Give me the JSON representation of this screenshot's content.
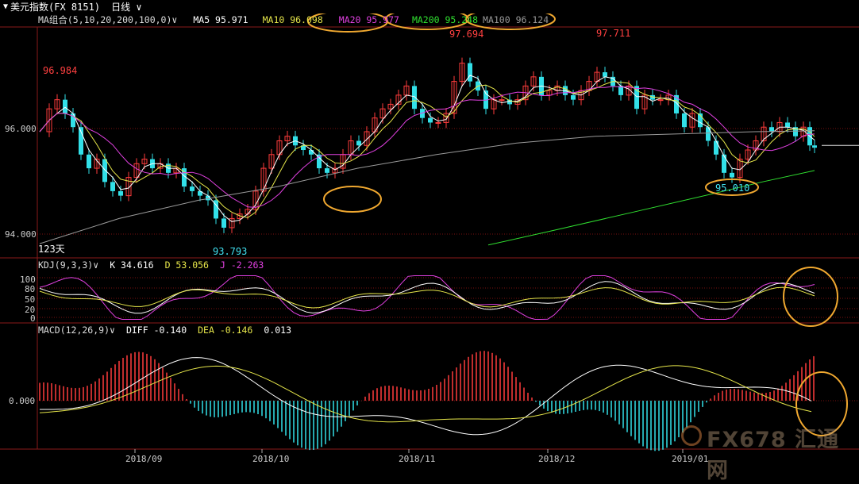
{
  "header": {
    "symbol_title": "美元指数(FX 8151)",
    "period": "日线",
    "period_arrow": "∨"
  },
  "ma_legend": {
    "label": "MA组合(5,10,20,200,100,0)",
    "arrow": "∨",
    "items": [
      {
        "text": "MA5 95.971",
        "color": "#ffffff"
      },
      {
        "text": "MA10 96.098",
        "color": "#e6e64a"
      },
      {
        "text": "MA20 95.977",
        "color": "#e040e0"
      },
      {
        "text": "MA200 95.248",
        "color": "#30e030"
      },
      {
        "text": "MA100 96.124",
        "color": "#9a9a9a"
      }
    ]
  },
  "kdj_legend": {
    "label": "KDJ(9,3,3)",
    "arrow": "∨",
    "items": [
      {
        "text": "K 34.616",
        "color": "#ffffff"
      },
      {
        "text": "D 53.056",
        "color": "#e6e64a"
      },
      {
        "text": "J -2.263",
        "color": "#e040e0"
      }
    ]
  },
  "macd_legend": {
    "label": "MACD(12,26,9)",
    "arrow": "∨",
    "items": [
      {
        "text": "DIFF -0.140",
        "color": "#ffffff"
      },
      {
        "text": "DEA -0.146",
        "color": "#e6e64a"
      },
      {
        "text": "0.013",
        "color": "#ffffff"
      }
    ]
  },
  "price_axis": {
    "ticks": [
      "96.000",
      "94.000"
    ],
    "values": [
      96.0,
      94.0
    ]
  },
  "kdj_axis": {
    "ticks": [
      "100",
      "80",
      "50",
      "20",
      "0"
    ],
    "values": [
      100,
      80,
      50,
      20,
      0
    ]
  },
  "macd_axis": {
    "ticks": [
      "0.000"
    ]
  },
  "date_axis": [
    "2018/09",
    "2018/10",
    "2018/11",
    "2018/12",
    "2019/01"
  ],
  "annotations": {
    "high_left": "96.984",
    "low": "93.793",
    "high_mid": "97.694",
    "high_right": "97.711",
    "low_recent": "95.010",
    "day_count": "123天"
  },
  "watermark": "FX678 汇通网",
  "colors": {
    "up": "#ff3c3c",
    "down": "#32e0e8",
    "ma5": "#ffffff",
    "ma10": "#e6e64a",
    "ma20": "#e040e0",
    "ma200": "#30e030",
    "ma100": "#9a9a9a",
    "highlight_ellipse": "#f0a830",
    "grid": "#7a1010"
  },
  "chart_data": {
    "type": "candlestick",
    "panels": [
      "price",
      "kdj",
      "macd"
    ],
    "price_ylim": [
      93.6,
      98.2
    ],
    "price_extremes": [
      {
        "label": "96.984",
        "value": 96.984
      },
      {
        "label": "93.793",
        "value": 93.793
      },
      {
        "label": "97.694",
        "value": 97.694
      },
      {
        "label": "97.711",
        "value": 97.711
      },
      {
        "label": "95.010",
        "value": 95.01
      }
    ],
    "ma_last": {
      "MA5": 95.971,
      "MA10": 96.098,
      "MA20": 95.977,
      "MA200": 95.248,
      "MA100": 96.124
    },
    "kdj_last": {
      "K": 34.616,
      "D": 53.056,
      "J": -2.263
    },
    "macd_last": {
      "DIFF": -0.14,
      "DEA": -0.146,
      "MACD": 0.013
    }
  }
}
